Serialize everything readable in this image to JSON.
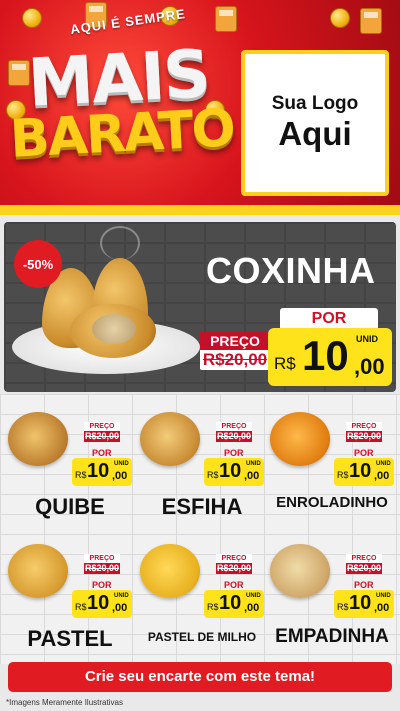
{
  "header": {
    "arc_text": "AQUI É SEMPRE",
    "title_top": "MAIS",
    "title_bottom": "BARATO",
    "logo_line1": "Sua Logo",
    "logo_line2": "Aqui"
  },
  "hero": {
    "badge": "-50%",
    "product": "COXINHA",
    "preco_label": "PREÇO",
    "old_price": "R$20,00",
    "por_label": "POR",
    "currency": "R$",
    "price_int": "10",
    "price_dec": ",00",
    "unit": "UNID"
  },
  "products": [
    {
      "name": "QUIBE",
      "preco_label": "PREÇO",
      "old_price": "R$20,00",
      "por_label": "POR",
      "currency": "R$",
      "price_int": "10",
      "price_dec": ",00",
      "unit": "UNID"
    },
    {
      "name": "ESFIHA",
      "preco_label": "PREÇO",
      "old_price": "R$20,00",
      "por_label": "POR",
      "currency": "R$",
      "price_int": "10",
      "price_dec": ",00",
      "unit": "UNID"
    },
    {
      "name": "ENROLADINHO",
      "preco_label": "PREÇO",
      "old_price": "R$20,00",
      "por_label": "POR",
      "currency": "R$",
      "price_int": "10",
      "price_dec": ",00",
      "unit": "UNID"
    },
    {
      "name": "PASTEL",
      "preco_label": "PREÇO",
      "old_price": "R$20,00",
      "por_label": "POR",
      "currency": "R$",
      "price_int": "10",
      "price_dec": ",00",
      "unit": "UNID"
    },
    {
      "name": "PASTEL DE MILHO",
      "preco_label": "PREÇO",
      "old_price": "R$20,00",
      "por_label": "POR",
      "currency": "R$",
      "price_int": "10",
      "price_dec": ",00",
      "unit": "UNID"
    },
    {
      "name": "EMPADINHA",
      "preco_label": "PREÇO",
      "old_price": "R$20,00",
      "por_label": "POR",
      "currency": "R$",
      "price_int": "10",
      "price_dec": ",00",
      "unit": "UNID"
    }
  ],
  "cta": "Crie seu encarte com este tema!",
  "footnote": "*Imagens Meramente Ilustrativas",
  "colors": {
    "brand_red": "#e01b21",
    "price_yellow": "#ffe31a",
    "accent_gold": "#ffcf1f"
  }
}
